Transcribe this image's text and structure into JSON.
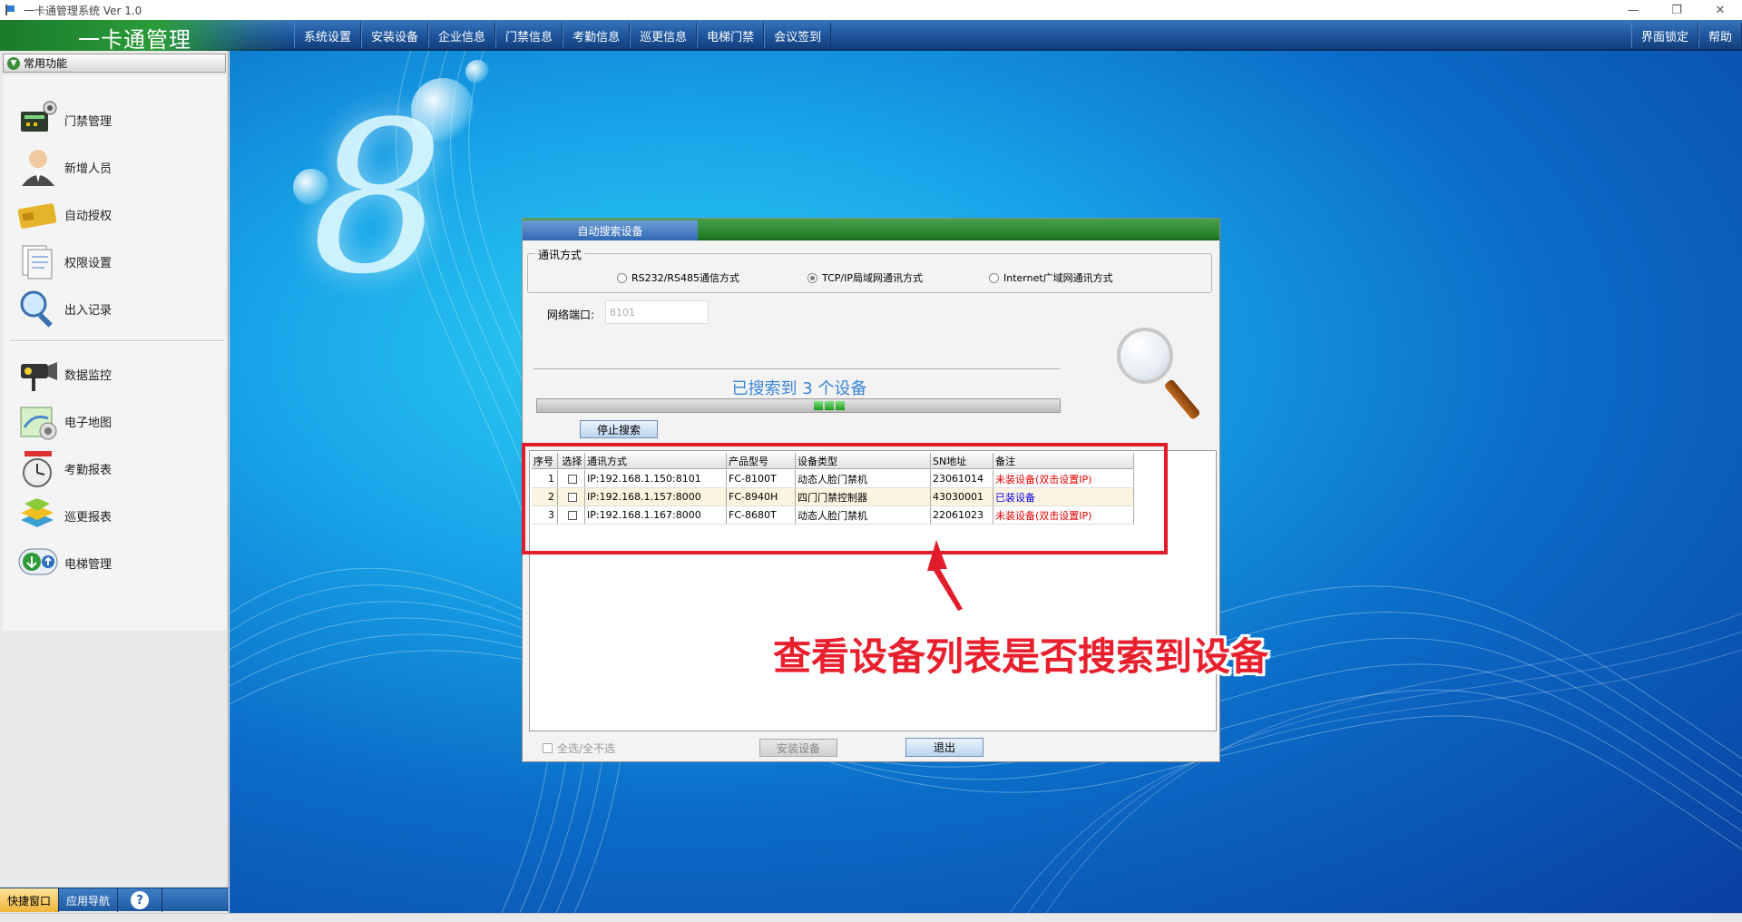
{
  "window": {
    "title": "一卡通管理系统 Ver 1.0",
    "controls": [
      "—",
      "❐",
      "✕"
    ]
  },
  "header": {
    "logo_text": "一卡通管理",
    "menu": [
      "系统设置",
      "安装设备",
      "企业信息",
      "门禁信息",
      "考勤信息",
      "巡更信息",
      "电梯门禁",
      "会议签到"
    ],
    "menu_right": [
      "界面锁定",
      "帮助"
    ]
  },
  "sidebar": {
    "title": "常用功能",
    "items": [
      {
        "label": "门禁管理",
        "icon": "door-controller-icon"
      },
      {
        "label": "新增人员",
        "icon": "person-icon"
      },
      {
        "label": "自动授权",
        "icon": "card-icon"
      },
      {
        "label": "权限设置",
        "icon": "documents-icon"
      },
      {
        "label": "出入记录",
        "icon": "magnifier-icon"
      },
      {
        "label": "数据监控",
        "icon": "camera-icon"
      },
      {
        "label": "电子地图",
        "icon": "map-icon"
      },
      {
        "label": "考勤报表",
        "icon": "clock-icon"
      },
      {
        "label": "巡更报表",
        "icon": "patrol-icon"
      },
      {
        "label": "电梯管理",
        "icon": "elevator-icon"
      }
    ],
    "footer_tabs": [
      "快捷窗口",
      "应用导航"
    ],
    "help": "?"
  },
  "dialog": {
    "tab": "自动搜索设备",
    "group_title": "通讯方式",
    "options": [
      "RS232/RS485通信方式",
      "TCP/IP局域网通讯方式",
      "Internet广域网通讯方式"
    ],
    "selected_option": 1,
    "port_label": "网络端口:",
    "port_value": "8101",
    "found_text": "已搜索到  3 个设备",
    "progress_pct": 50,
    "stop_button": "停止搜索",
    "columns": [
      "序号",
      "选择",
      "通讯方式",
      "产品型号",
      "设备类型",
      "SN地址",
      "备注"
    ],
    "rows": [
      {
        "no": "1",
        "comm": "IP:192.168.1.150:8101",
        "model": "FC-8100T",
        "type": "动态人脸门禁机",
        "sn": "23061014",
        "note": "未装设备(双击设置IP)",
        "note_color": "#e00000"
      },
      {
        "no": "2",
        "comm": "IP:192.168.1.157:8000",
        "model": "FC-8940H",
        "type": "四门门禁控制器",
        "sn": "43030001",
        "note": "已装设备",
        "note_color": "#0000e0"
      },
      {
        "no": "3",
        "comm": "IP:192.168.1.167:8000",
        "model": "FC-8680T",
        "type": "动态人脸门禁机",
        "sn": "22061023",
        "note": "未装设备(双击设置IP)",
        "note_color": "#e00000"
      }
    ],
    "select_all": "全选/全不选",
    "install_button": "安装设备",
    "exit_button": "退出"
  },
  "annotation": {
    "text": "查看设备列表是否搜索到设备",
    "color": "#e11d2b"
  },
  "background": {
    "decor_digit": "8"
  }
}
